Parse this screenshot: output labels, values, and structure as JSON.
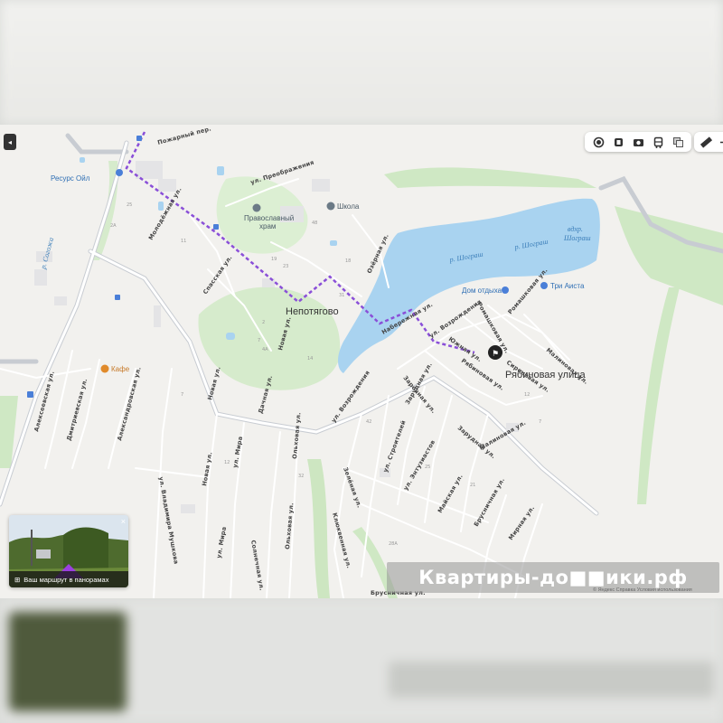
{
  "map": {
    "settlement": "Непотягово",
    "selected_street": "Рябиновая улица",
    "pois": {
      "resource": "Ресурс Ойл",
      "church_line1": "Православный",
      "church_line2": "храм",
      "school": "Школа",
      "cafe": "Кафе",
      "rest_house": "Дом отдыха",
      "three_storks": "Три Аиста"
    },
    "water": {
      "river1": "р. Шограш",
      "river2": "р. Шограш",
      "reservoir_line1": "вдхр.",
      "reservoir_line2": "Шограш",
      "river_sogozha": "р. Согожа"
    },
    "streets": {
      "preobrazhenia": "ул. Преображения",
      "molodezhnaya": "Молодёжная ул.",
      "spasskaya": "Спасская ул.",
      "ozernaya": "Озёрная ул.",
      "naberezhnaya": "Набережная ул.",
      "vozrozhdenia": "ул. Возрождения",
      "vozrozhdenia2": "ул. Возрождения",
      "ryabinovaya": "Рябиновая ул.",
      "yuzhnaya": "Южная ул.",
      "romashkovaya1": "Ромашковая ул.",
      "romashkovaya2": "Ромашковая ул.",
      "sirenevaya": "Сиреневая ул.",
      "malinovaya1": "Малиновая ул.",
      "malinovaya2": "Малиновая ул.",
      "zarechnaya": "Заречная ул.",
      "zarudnaya1": "Зарудная ул.",
      "zarudnaya2": "Зарудная ул.",
      "alekseevskaya": "Алексеевская ул.",
      "dmitrievskaya": "Дмитриевская ул.",
      "aleksandrovskaya": "Александровская ул.",
      "novaya1": "Новая ул.",
      "novaya2": "Новая ул.",
      "novaya3": "Новая ул.",
      "dachnaya": "Дачная ул.",
      "mira1": "ул. Мира",
      "mira2": "ул. Мира",
      "olkhovaya1": "Ольховая ул.",
      "olkhovaya2": "Ольховая ул.",
      "vladimira": "ул. Владимира Мушкова",
      "stroiteley": "ул. Строителей",
      "entuziastov": "ул. Энтузиастов",
      "mayskaya": "Майская ул.",
      "brusnichnaya1": "Брусничная ул.",
      "brusnichnaya2": "Брусничная ул.",
      "klyukvennaya": "Клюквенная ул.",
      "mirnaya": "Мирная ул.",
      "zelenaya": "Зелёная ул.",
      "solnechnaya": "Солнечная ул.",
      "pozharny": "Пожарный пер."
    }
  },
  "toolbar": {
    "tools": [
      "layers-icon",
      "traffic-icon",
      "camera-icon",
      "transit-icon",
      "panorama-layers-icon"
    ],
    "ruler": "ruler-icon"
  },
  "panorama": {
    "caption": "Ваш маршрут в панорамах",
    "close": "×"
  },
  "watermark": "Квартиры-до■■ики.рф",
  "copyright": "© Яндекс   Справка   Условия использования",
  "colors": {
    "water": "#a9d3f0",
    "forest": "#cfe8c4",
    "route": "#8a4fd8",
    "road": "#ffffff"
  }
}
